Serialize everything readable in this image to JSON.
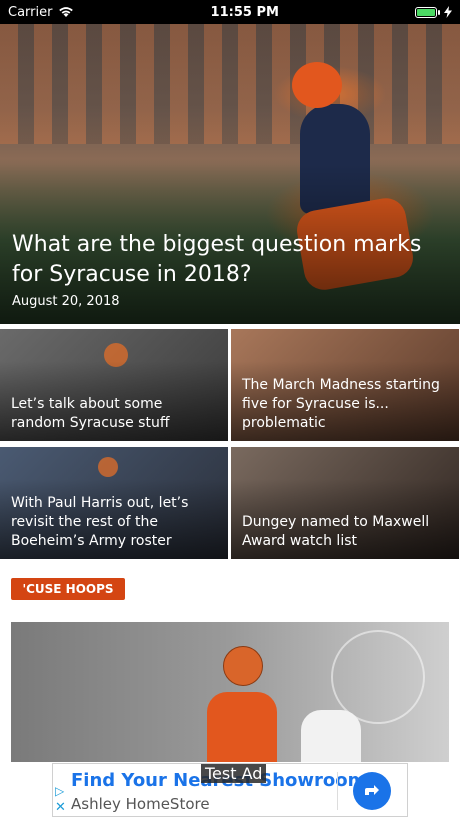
{
  "status_bar": {
    "carrier": "Carrier",
    "time": "11:55 PM"
  },
  "hero": {
    "title": "What are the biggest question marks for Syracuse in 2018?",
    "date": "August 20, 2018"
  },
  "grid": [
    {
      "title": "Let’s talk about some random Syracuse stuff"
    },
    {
      "title": "The March Madness starting five for Syracuse is... problematic"
    },
    {
      "title": "With Paul Harris out, let’s revisit the rest of the Boeheim’s Army roster"
    },
    {
      "title": "Dungey named to Maxwell Award watch list"
    }
  ],
  "section": {
    "tag": "'CUSE HOOPS"
  },
  "ad": {
    "label": "Test Ad",
    "headline": "Find Your Nearest Showroom",
    "advertiser": "Ashley HomeStore"
  },
  "colors": {
    "accent": "#d44512",
    "ad_link": "#1a73e8",
    "battery": "#4cd964"
  }
}
